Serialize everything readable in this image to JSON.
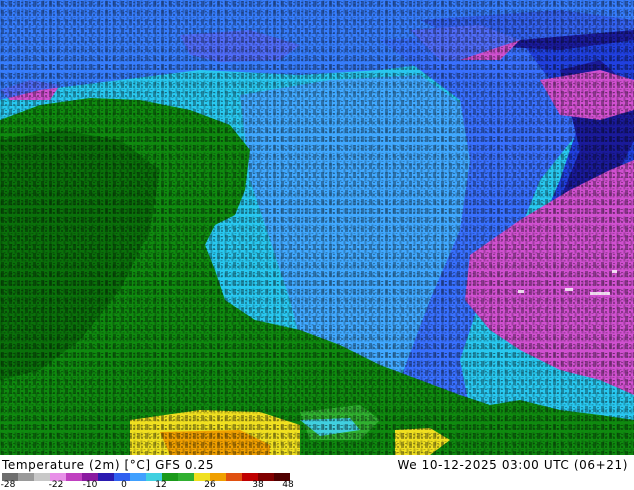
{
  "footer": {
    "title_left": "Temperature (2m) [°C]",
    "model": "GFS 0.25",
    "datetime": "We 10-12-2025 03:00 UTC (06+21)"
  },
  "colorscale": {
    "tick_labels": [
      "-28",
      "-22",
      "-10",
      "0",
      "12",
      "26",
      "38",
      "48"
    ],
    "colors": [
      "#6e6e6e",
      "#9a9a9a",
      "#c8c8c8",
      "#e890e8",
      "#c040c0",
      "#8a1aa0",
      "#2a1ab0",
      "#3060f0",
      "#40a0ff",
      "#40d0e0",
      "#1a9a1a",
      "#30b030",
      "#f0e020",
      "#f0a000",
      "#e05010",
      "#c00000",
      "#800000",
      "#500000"
    ]
  },
  "map": {
    "regions": {
      "land": "#0f8a0f",
      "land_dark": "#0a700a",
      "sea_cyan": "#28c8f0",
      "sea_light_blue": "#40a8ff",
      "sea_blue": "#3870ff",
      "cold_blue": "#2040e0",
      "deep_blue": "#1a1a9a",
      "magenta": "#d050d0",
      "warm_yellow": "#f0e020",
      "warm_orange": "#f0a000"
    },
    "numeral_chars": "0123456789"
  }
}
